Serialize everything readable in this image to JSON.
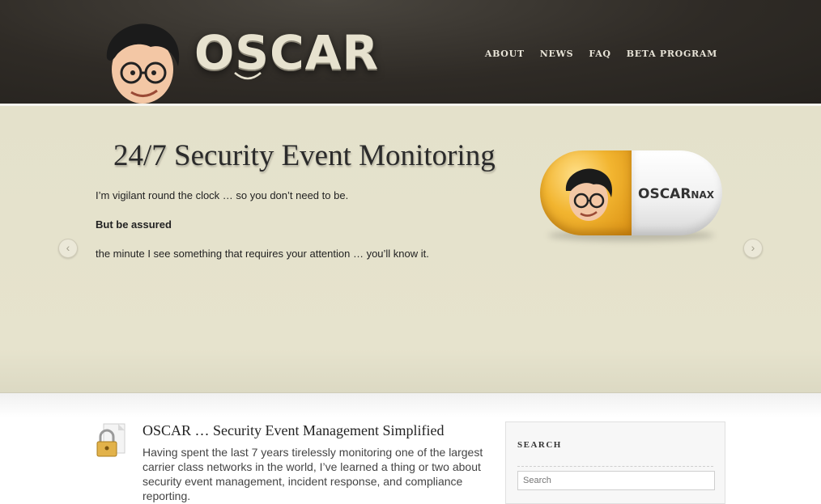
{
  "header": {
    "logo_text": "OSCAR",
    "nav": [
      "About",
      "News",
      "FAQ",
      "Beta Program"
    ]
  },
  "hero": {
    "title": "24/7 Security Event Monitoring",
    "line1": "I’m vigilant round the clock … so you don’t need to be.",
    "line2": "But be assured",
    "line3": "the minute I see something that requires your attention … you’ll know it.",
    "pill_brand": "OSCAR",
    "pill_suffix": "nax",
    "prev_icon": "‹",
    "next_icon": "›"
  },
  "post": {
    "title": "OSCAR … Security Event Management Simplified",
    "body": "Having spent the last 7 years tirelessly monitoring one of the largest carrier class networks in the world, I’ve learned a thing or two about security event management, incident response, and compliance reporting."
  },
  "sidebar": {
    "heading": "SEARCH",
    "search_placeholder": "Search"
  },
  "colors": {
    "header_bg": "#2f2b26",
    "hero_bg": "#e5e2cc",
    "pill_orange": "#f2b530"
  }
}
